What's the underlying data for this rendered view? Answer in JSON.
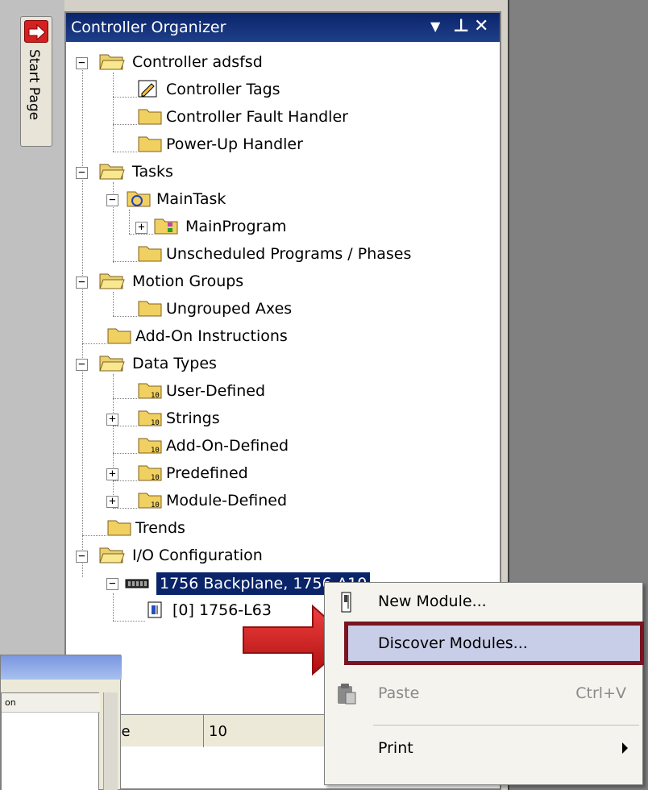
{
  "panel": {
    "title": "Controller Organizer",
    "start_page_tab": "Start Page"
  },
  "tree": {
    "controller": "Controller adsfsd",
    "controller_tags": "Controller Tags",
    "controller_fault_handler": "Controller Fault Handler",
    "power_up_handler": "Power-Up Handler",
    "tasks": "Tasks",
    "main_task": "MainTask",
    "main_program": "MainProgram",
    "unscheduled": "Unscheduled Programs / Phases",
    "motion_groups": "Motion Groups",
    "ungrouped_axes": "Ungrouped Axes",
    "add_on_instructions": "Add-On Instructions",
    "data_types": "Data Types",
    "user_defined": "User-Defined",
    "strings": "Strings",
    "add_on_defined": "Add-On-Defined",
    "predefined": "Predefined",
    "module_defined": "Module-Defined",
    "trends": "Trends",
    "io_configuration": "I/O Configuration",
    "backplane": "1756 Backplane, 1756-A10",
    "slot0": "[0] 1756-L63"
  },
  "properties": {
    "label": "ize",
    "value": "10"
  },
  "dialog": {
    "column": "on"
  },
  "context_menu": {
    "new_module": "New Module...",
    "discover_modules": "Discover Modules...",
    "paste": "Paste",
    "paste_shortcut": "Ctrl+V",
    "print": "Print"
  },
  "colors": {
    "titlebar": "#0a246a",
    "highlight_border": "#7a1420",
    "arrow": "#d42020"
  }
}
